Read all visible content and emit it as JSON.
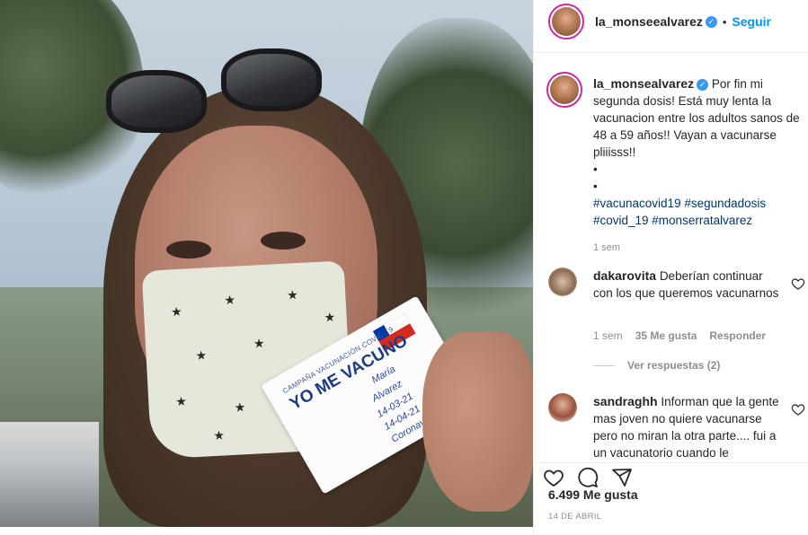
{
  "post": {
    "author": "la_monseealvarez",
    "follow_dot": "•",
    "follow_label": "Seguir",
    "photo": {
      "card_campaign": "CAMPAÑA VACUNACIÓN COVID-19",
      "card_title": "YO ME VACUNO",
      "card_name": "María",
      "card_surname": "Alvarez",
      "card_date1": "14-03-21",
      "card_date2": "14-04-21",
      "card_vaccine": "Coronavac"
    },
    "caption": {
      "author": "la_monsealvarez",
      "text": "Por fin mi segunda dosis! Está muy lenta la vacunacion entre los adultos sanos de 48 a 59 años!! Vayan a vacunarse pliiisss!!",
      "dot1": "•",
      "dot2": "•",
      "hashtags": "#vacunacovid19 #segundadosis #covid_19 #monserratalvarez",
      "time": "1 sem"
    },
    "comments": [
      {
        "author": "dakarovita",
        "text": "Deberían continuar con los que queremos vacunarnos",
        "time": "1 sem",
        "likes": "35 Me gusta",
        "reply": "Responder",
        "view_replies": "Ver respuestas (2)"
      },
      {
        "author": "sandraghh",
        "text": "Informan que la gente mas joven no quiere vacunarse pero no miran la otra parte.... fui a un vacunatorio cuando le"
      }
    ],
    "likes_count": "6.499 Me gusta",
    "date": "14 DE ABRIL"
  },
  "icons": {
    "verified": "verified-badge-icon",
    "heart": "heart-icon",
    "comment": "comment-icon",
    "share": "share-icon"
  },
  "colors": {
    "accent": "#0095f6",
    "hashtag": "#00376b",
    "muted": "#8e8e8e",
    "verified": "#3897f0",
    "story_ring": "#d6249f"
  }
}
